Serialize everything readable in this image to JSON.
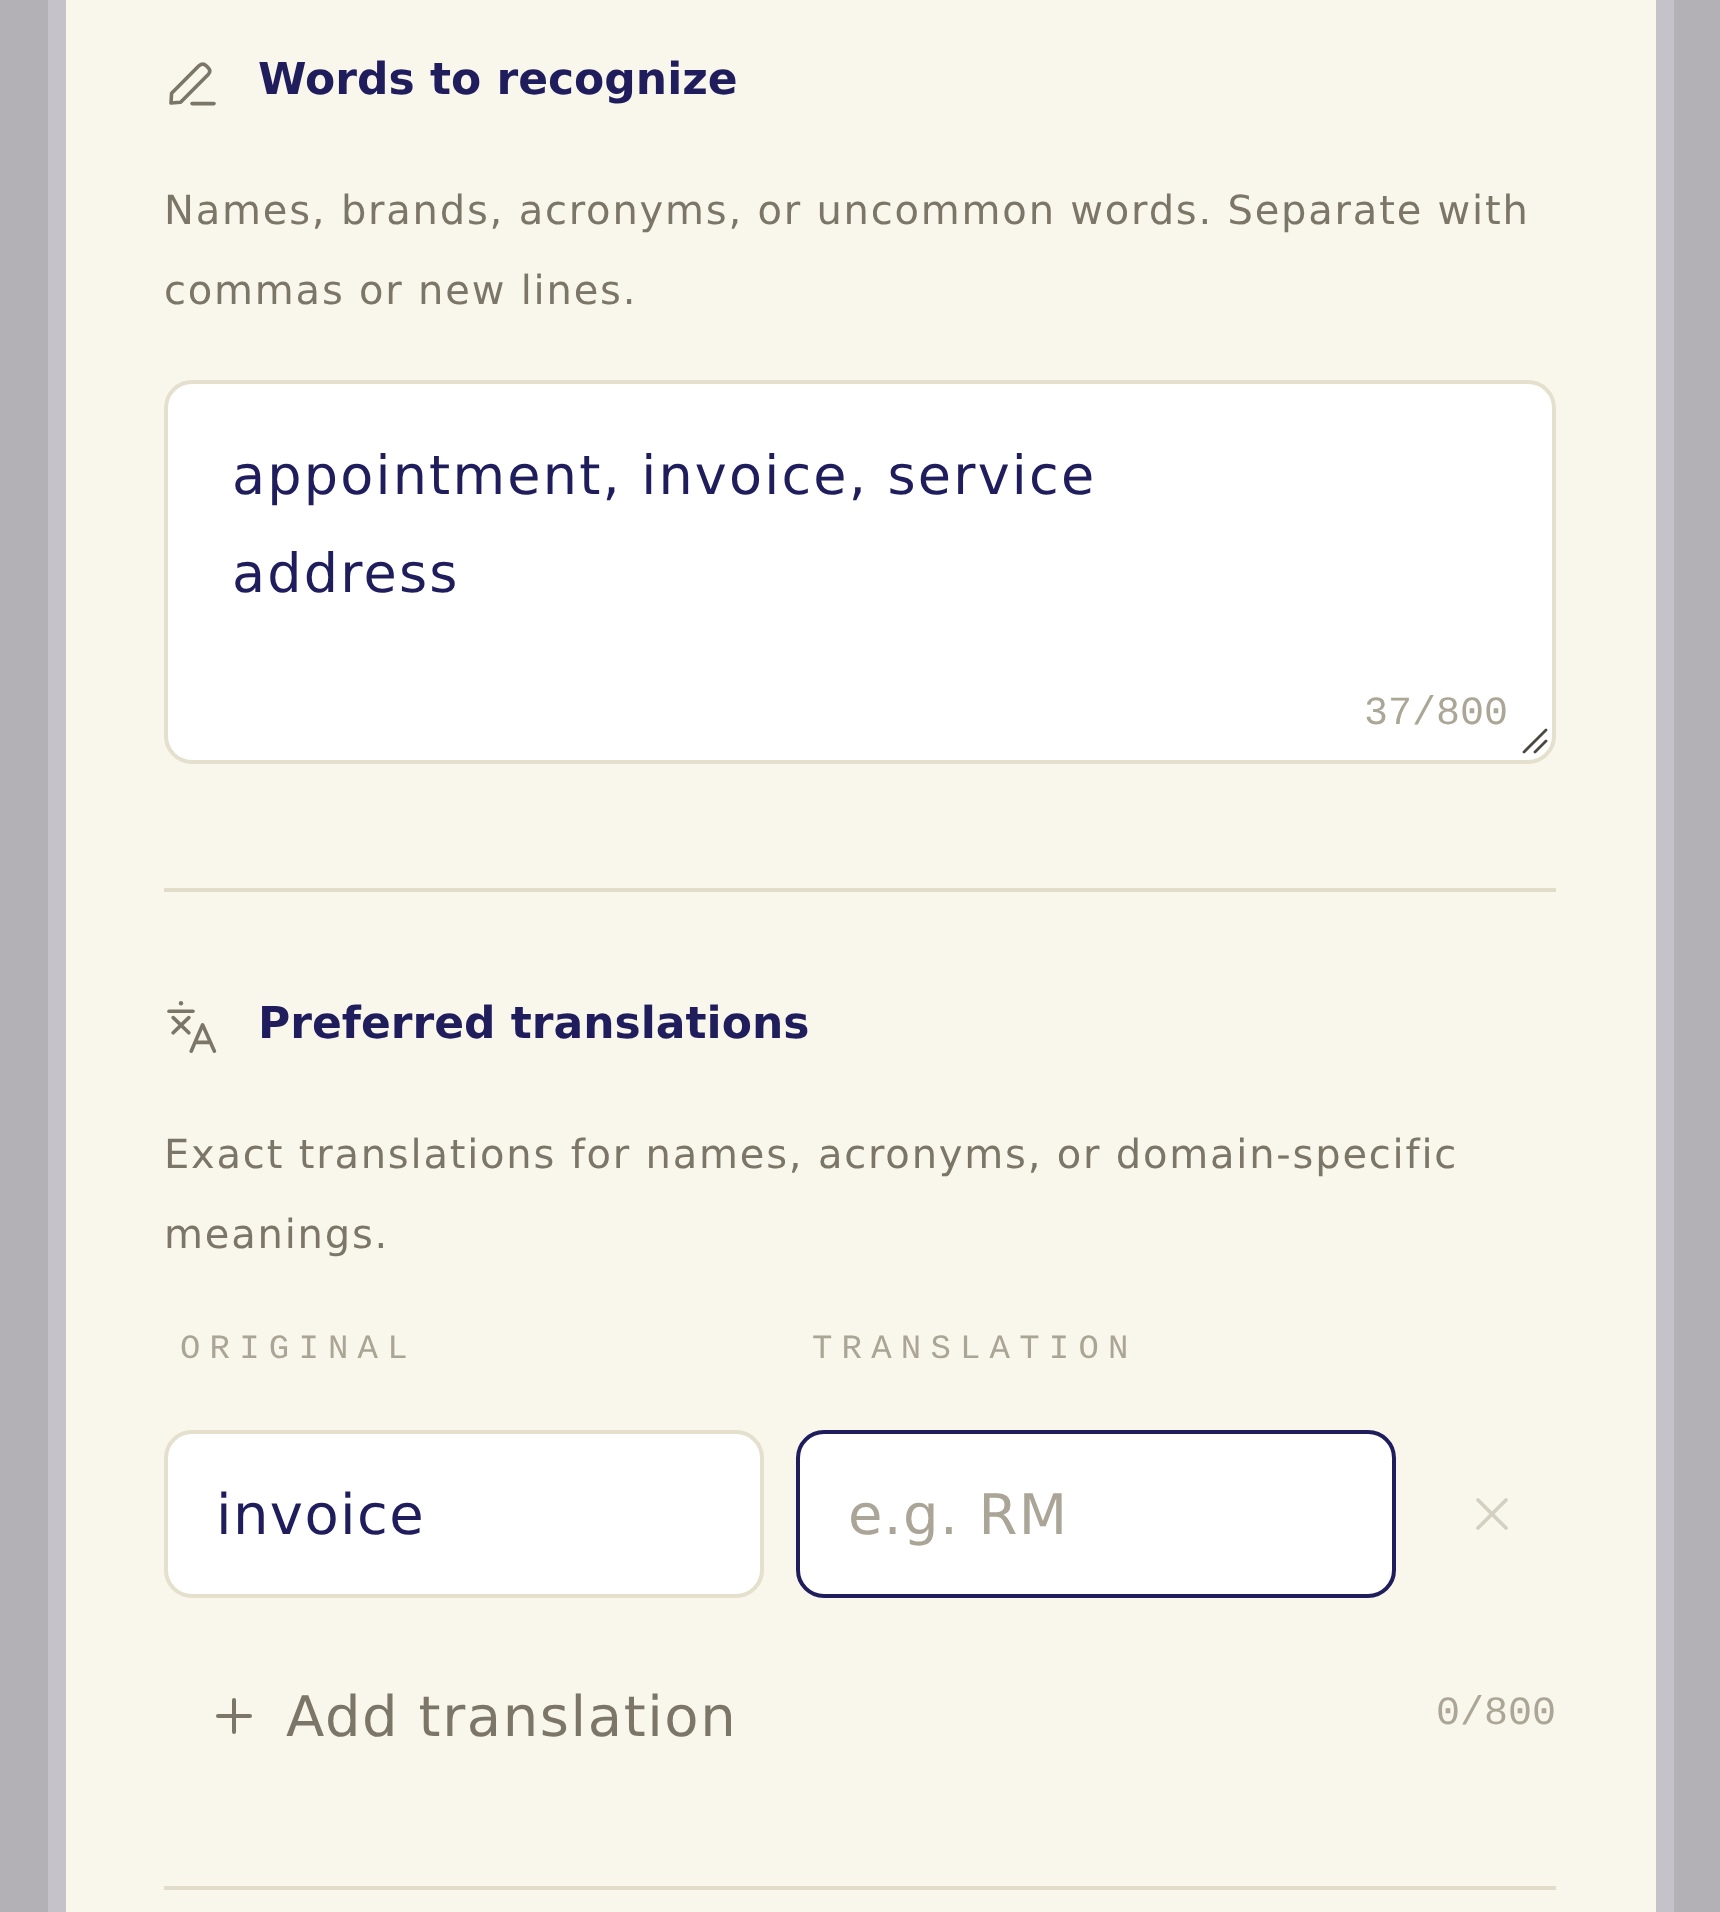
{
  "sections": [
    {
      "kind": "words",
      "title": "Words to recognize",
      "description": "Names, brands, acronyms, or uncommon words. Separate with commas or new lines.",
      "field": {
        "value": "appointment, invoice, service\naddress",
        "counter": "37/800"
      }
    },
    {
      "kind": "translations",
      "title": "Preferred translations",
      "description": "Exact translations for names, acronyms, or domain-specific meanings.",
      "columns": [
        "ORIGINAL",
        "TRANSLATION"
      ],
      "rows": [
        {
          "original": {
            "value": "invoice",
            "focused": false
          },
          "translation": {
            "placeholder": "e.g. RM",
            "focused": true
          }
        }
      ],
      "add_button": "Add translation",
      "counter": "0/800"
    }
  ]
}
